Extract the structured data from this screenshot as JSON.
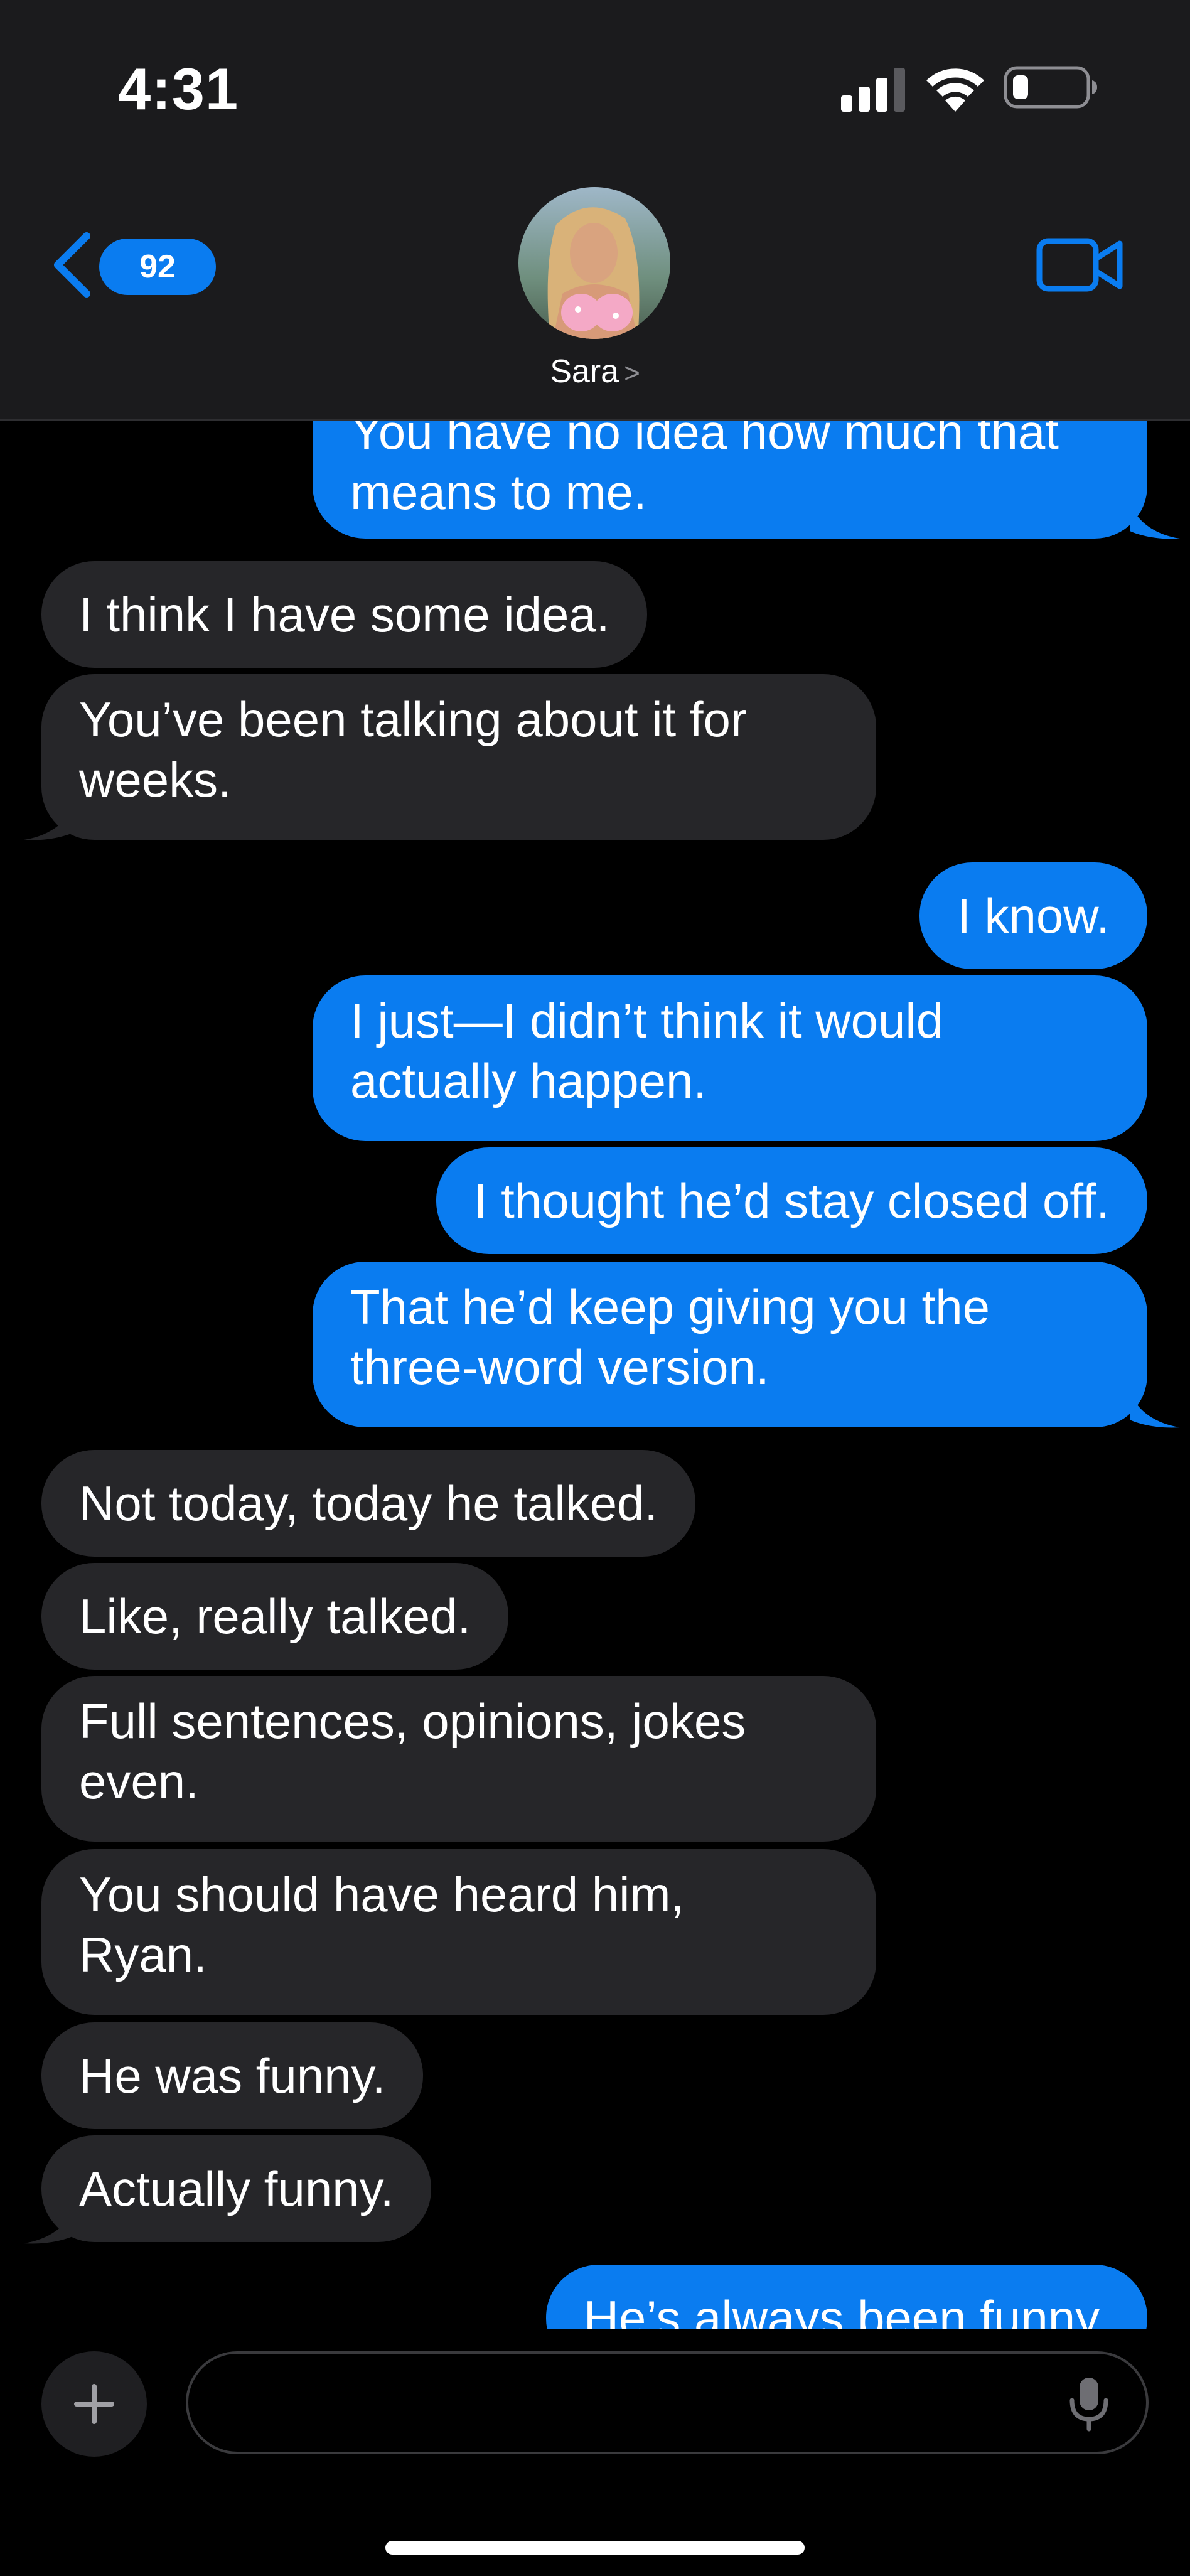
{
  "status_bar": {
    "time": "4:31"
  },
  "header": {
    "back_count": "92",
    "contact_name": "Sara",
    "contact_chevron": ">"
  },
  "messages": [
    {
      "from": "me",
      "text": "You have no idea how much that\nmeans to me."
    },
    {
      "from": "them",
      "text": "I think I have some idea."
    },
    {
      "from": "them",
      "text": "You’ve been talking about it for\nweeks."
    },
    {
      "from": "me",
      "text": "I know."
    },
    {
      "from": "me",
      "text": "I just—I didn’t think it would\nactually happen."
    },
    {
      "from": "me",
      "text": "I thought he’d stay closed off."
    },
    {
      "from": "me",
      "text": "That he’d keep giving you the\nthree-word version."
    },
    {
      "from": "them",
      "text": "Not today, today he talked."
    },
    {
      "from": "them",
      "text": "Like, really talked."
    },
    {
      "from": "them",
      "text": "Full sentences, opinions, jokes\neven."
    },
    {
      "from": "them",
      "text": "You should have heard him,\nRyan."
    },
    {
      "from": "them",
      "text": "He was funny."
    },
    {
      "from": "them",
      "text": "Actually funny."
    },
    {
      "from": "me",
      "text": "He’s always been funny."
    }
  ],
  "composer": {
    "placeholder": ""
  },
  "colors": {
    "outgoing": "#0a7cf0",
    "incoming": "#262629",
    "header_bg": "#1b1b1d",
    "accent": "#0a7cf0"
  },
  "icons": {
    "signal": "cellular-signal-icon",
    "wifi": "wifi-icon",
    "battery": "battery-low-icon",
    "back": "chevron-left-icon",
    "video": "video-camera-icon",
    "plus": "plus-icon",
    "mic": "microphone-icon"
  }
}
